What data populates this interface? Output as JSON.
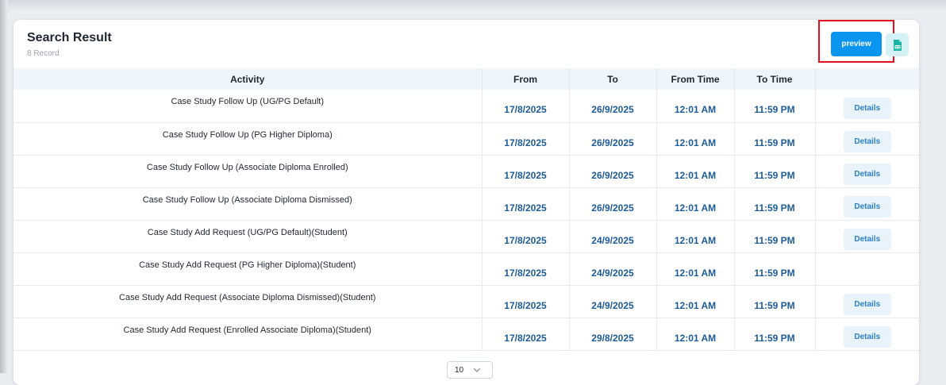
{
  "search_result": {
    "title": "Search Result",
    "record_count": "8 Record"
  },
  "toolbar": {
    "preview_label": "preview",
    "excel_icon": "excel-export-icon",
    "highlight_color": "#e3101b"
  },
  "table": {
    "headers": {
      "activity": "Activity",
      "from": "From",
      "to": "To",
      "from_time": "From Time",
      "to_time": "To Time"
    },
    "rows": [
      {
        "activity": "Case Study Follow Up (UG/PG Default)",
        "from": "17/8/2025",
        "to": "26/9/2025",
        "from_time": "12:01 AM",
        "to_time": "11:59 PM",
        "details": "Details"
      },
      {
        "activity": "Case Study Follow Up (PG Higher Diploma)",
        "from": "17/8/2025",
        "to": "26/9/2025",
        "from_time": "12:01 AM",
        "to_time": "11:59 PM",
        "details": "Details"
      },
      {
        "activity": "Case Study Follow Up (Associate Diploma Enrolled)",
        "from": "17/8/2025",
        "to": "26/9/2025",
        "from_time": "12:01 AM",
        "to_time": "11:59 PM",
        "details": "Details"
      },
      {
        "activity": "Case Study Follow Up (Associate Diploma Dismissed)",
        "from": "17/8/2025",
        "to": "26/9/2025",
        "from_time": "12:01 AM",
        "to_time": "11:59 PM",
        "details": "Details"
      },
      {
        "activity": "Case Study Add Request (UG/PG Default)(Student)",
        "from": "17/8/2025",
        "to": "24/9/2025",
        "from_time": "12:01 AM",
        "to_time": "11:59 PM",
        "details": "Details"
      },
      {
        "activity": "Case Study Add Request (PG Higher Diploma)(Student)",
        "from": "17/8/2025",
        "to": "24/9/2025",
        "from_time": "12:01 AM",
        "to_time": "11:59 PM",
        "details": ""
      },
      {
        "activity": "Case Study Add Request (Associate Diploma Dismissed)(Student)",
        "from": "17/8/2025",
        "to": "24/9/2025",
        "from_time": "12:01 AM",
        "to_time": "11:59 PM",
        "details": "Details"
      },
      {
        "activity": "Case Study Add Request (Enrolled Associate Diploma)(Student)",
        "from": "17/8/2025",
        "to": "29/8/2025",
        "from_time": "12:01 AM",
        "to_time": "11:59 PM",
        "details": "Details"
      }
    ]
  },
  "pagination": {
    "page_size": "10",
    "chevron_icon": "chevron-down-icon"
  }
}
